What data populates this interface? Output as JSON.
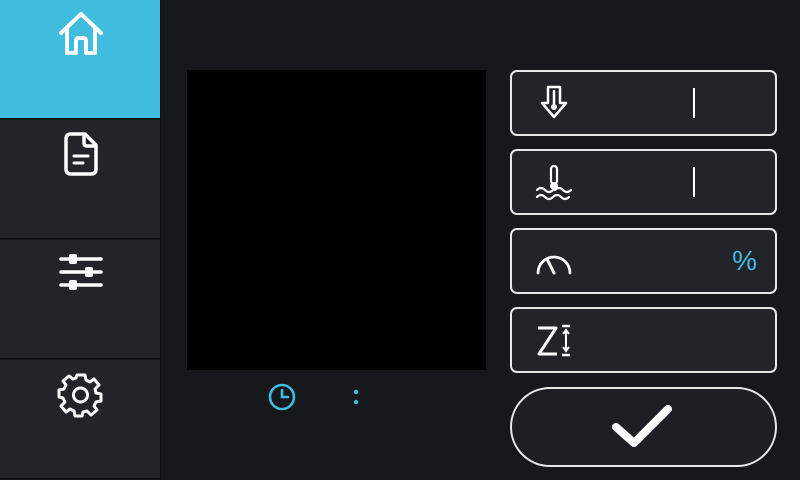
{
  "sidebar": {
    "items": [
      {
        "name": "home",
        "icon": "home-icon",
        "active": true
      },
      {
        "name": "files",
        "icon": "file-icon",
        "active": false
      },
      {
        "name": "tune",
        "icon": "sliders-icon",
        "active": false
      },
      {
        "name": "settings",
        "icon": "gear-icon",
        "active": false
      }
    ]
  },
  "preview": {
    "time_icon": "clock-icon",
    "more_icon": "more-vertical-icon"
  },
  "status_cards": [
    {
      "name": "nozzle-temp",
      "icon": "nozzle-temperature-icon",
      "value": ""
    },
    {
      "name": "bed-temp",
      "icon": "bed-temperature-icon",
      "value": ""
    },
    {
      "name": "speed",
      "icon": "speedometer-icon",
      "value": "%"
    },
    {
      "name": "z-offset",
      "icon": "z-offset-icon",
      "value": ""
    }
  ],
  "confirm": {
    "icon": "checkmark-icon"
  },
  "colors": {
    "accent": "#40bcde",
    "background": "#16181c",
    "panel": "#222429",
    "border": "#e8e8e8",
    "preview_bg": "#000000"
  }
}
